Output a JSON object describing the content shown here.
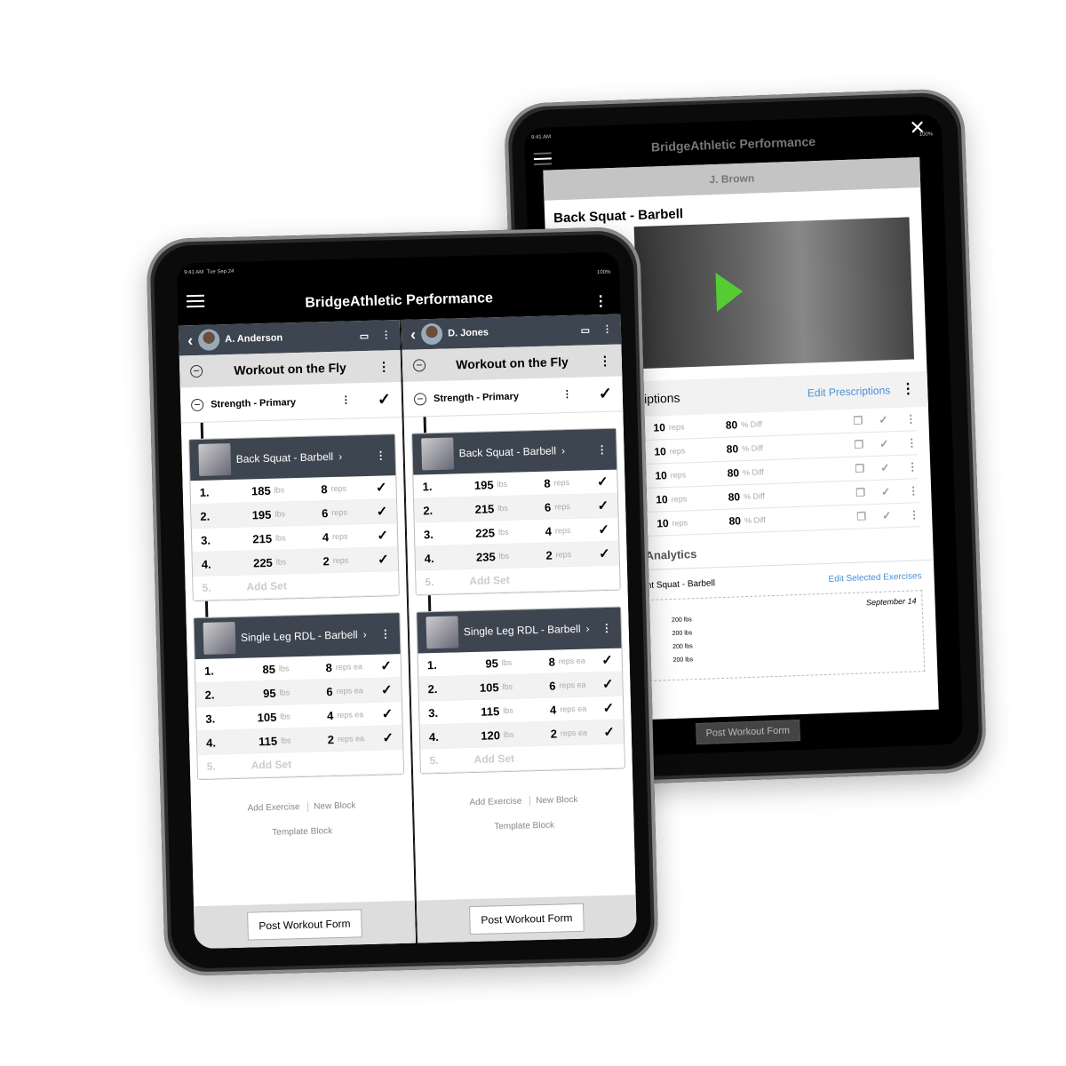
{
  "app": {
    "title": "BridgeAthletic Performance",
    "time": "9:41 AM",
    "date": "Tue Sep 24",
    "battery": "100%"
  },
  "back_tablet": {
    "athlete": "J. Brown",
    "exercise": "Back Squat - Barbell",
    "prescriptions_title": "riptions",
    "edit_prescriptions": "Edit Prescriptions",
    "rows": [
      {
        "reps": "10",
        "reps_unit": "reps",
        "diff": "80",
        "diff_unit": "% Diff"
      },
      {
        "reps": "10",
        "reps_unit": "reps",
        "diff": "80",
        "diff_unit": "% Diff"
      },
      {
        "reps": "10",
        "reps_unit": "reps",
        "diff": "80",
        "diff_unit": "% Diff"
      },
      {
        "reps": "10",
        "reps_unit": "reps",
        "diff": "80",
        "diff_unit": "% Diff"
      },
      {
        "reps": "10",
        "reps_unit": "reps",
        "diff": "80",
        "diff_unit": "% Diff"
      }
    ],
    "analytics_title": "Analytics",
    "analytics_exercise": "nt Squat - Barbell",
    "edit_selected": "Edit Selected Exercises",
    "chart_date": "September 14",
    "chart_values": [
      "200 lbs",
      "200 lbs",
      "200 lbs",
      "200 lbs"
    ],
    "post_workout": "Post Workout Form"
  },
  "panels": [
    {
      "athlete": "A. Anderson",
      "workout": "Workout on the Fly",
      "block": "Strength - Primary",
      "exercises": [
        {
          "name": "Back Squat - Barbell",
          "unit": "reps",
          "sets": [
            [
              "1.",
              "185",
              "8"
            ],
            [
              "2.",
              "195",
              "6"
            ],
            [
              "3.",
              "215",
              "4"
            ],
            [
              "4.",
              "225",
              "2"
            ]
          ]
        },
        {
          "name": "Single Leg RDL - Barbell",
          "unit": "reps ea",
          "sets": [
            [
              "1.",
              "85",
              "8"
            ],
            [
              "2.",
              "95",
              "6"
            ],
            [
              "3.",
              "105",
              "4"
            ],
            [
              "4.",
              "115",
              "2"
            ]
          ]
        }
      ],
      "add_set_num": "5.",
      "add_set": "Add Set",
      "weight_unit": "lbs",
      "add_exercise": "Add Exercise",
      "new_block": "New Block",
      "template_block": "Template Block",
      "post_workout": "Post Workout Form"
    },
    {
      "athlete": "D. Jones",
      "workout": "Workout on the Fly",
      "block": "Strength - Primary",
      "exercises": [
        {
          "name": "Back Squat - Barbell",
          "unit": "reps",
          "sets": [
            [
              "1.",
              "195",
              "8"
            ],
            [
              "2.",
              "215",
              "6"
            ],
            [
              "3.",
              "225",
              "4"
            ],
            [
              "4.",
              "235",
              "2"
            ]
          ]
        },
        {
          "name": "Single Leg RDL - Barbell",
          "unit": "reps ea",
          "sets": [
            [
              "1.",
              "95",
              "8"
            ],
            [
              "2.",
              "105",
              "6"
            ],
            [
              "3.",
              "115",
              "4"
            ],
            [
              "4.",
              "120",
              "2"
            ]
          ]
        }
      ],
      "add_set_num": "5.",
      "add_set": "Add Set",
      "weight_unit": "lbs",
      "add_exercise": "Add Exercise",
      "new_block": "New Block",
      "template_block": "Template Block",
      "post_workout": "Post Workout Form"
    }
  ]
}
